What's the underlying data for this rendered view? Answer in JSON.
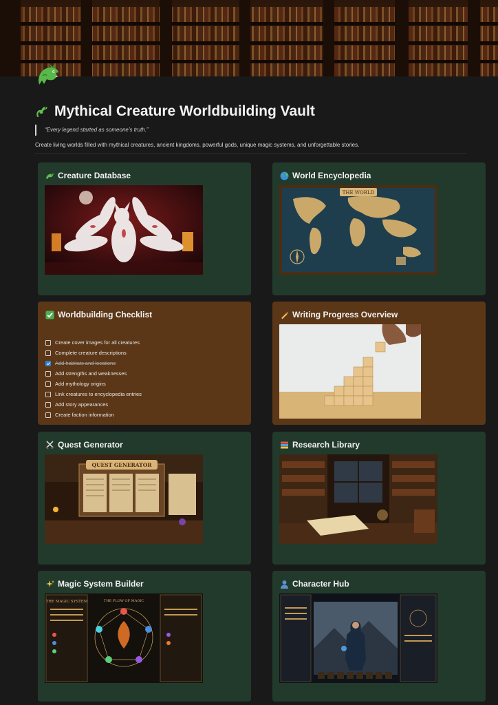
{
  "page": {
    "title": "Mythical Creature Worldbuilding Vault",
    "quote": "“Every legend started as someone’s truth.”",
    "description": "Create living worlds filled with mythical creatures, ancient kingdoms, powerful gods, unique magic systems, and unforgettable stories.",
    "icon": "dragon-icon"
  },
  "colors": {
    "background": "#191919",
    "card_green": "#223a2c",
    "card_brown": "#5b3718",
    "checkbox_checked": "#2f7fd1"
  },
  "cards": {
    "creature": {
      "title": "Creature Database",
      "icon": "dragon-icon"
    },
    "world": {
      "title": "World Encyclopedia",
      "icon": "globe-icon"
    },
    "checklist": {
      "title": "Worldbuilding Checklist",
      "icon": "check-mark-button-icon"
    },
    "writing": {
      "title": "Writing Progress Overview",
      "icon": "writing-hand-icon"
    },
    "quest": {
      "title": "Quest Generator",
      "icon": "crossed-swords-icon"
    },
    "research": {
      "title": "Research Library",
      "icon": "books-icon"
    },
    "magic": {
      "title": "Magic System Builder",
      "icon": "sparkles-icon"
    },
    "character": {
      "title": "Character Hub",
      "icon": "person-silhouette-icon"
    }
  },
  "checklist": {
    "items": [
      {
        "label": "Create cover images for all creatures",
        "checked": false
      },
      {
        "label": "Complete creature descriptions",
        "checked": false
      },
      {
        "label": "Add habitats and locations",
        "checked": true
      },
      {
        "label": "Add strengths and weaknesses",
        "checked": false
      },
      {
        "label": "Add mythology origins",
        "checked": false
      },
      {
        "label": "Link creatures to encyclopedia entries",
        "checked": false
      },
      {
        "label": "Add story appearances",
        "checked": false
      },
      {
        "label": "Create faction information",
        "checked": false
      }
    ]
  },
  "images": {
    "world_map_title": "THE WORLD",
    "quest_board_title": "QUEST GENERATOR",
    "magic_title": "THE MAGIC SYSTEM",
    "magic_center_title": "THE FLOW OF MAGIC"
  }
}
